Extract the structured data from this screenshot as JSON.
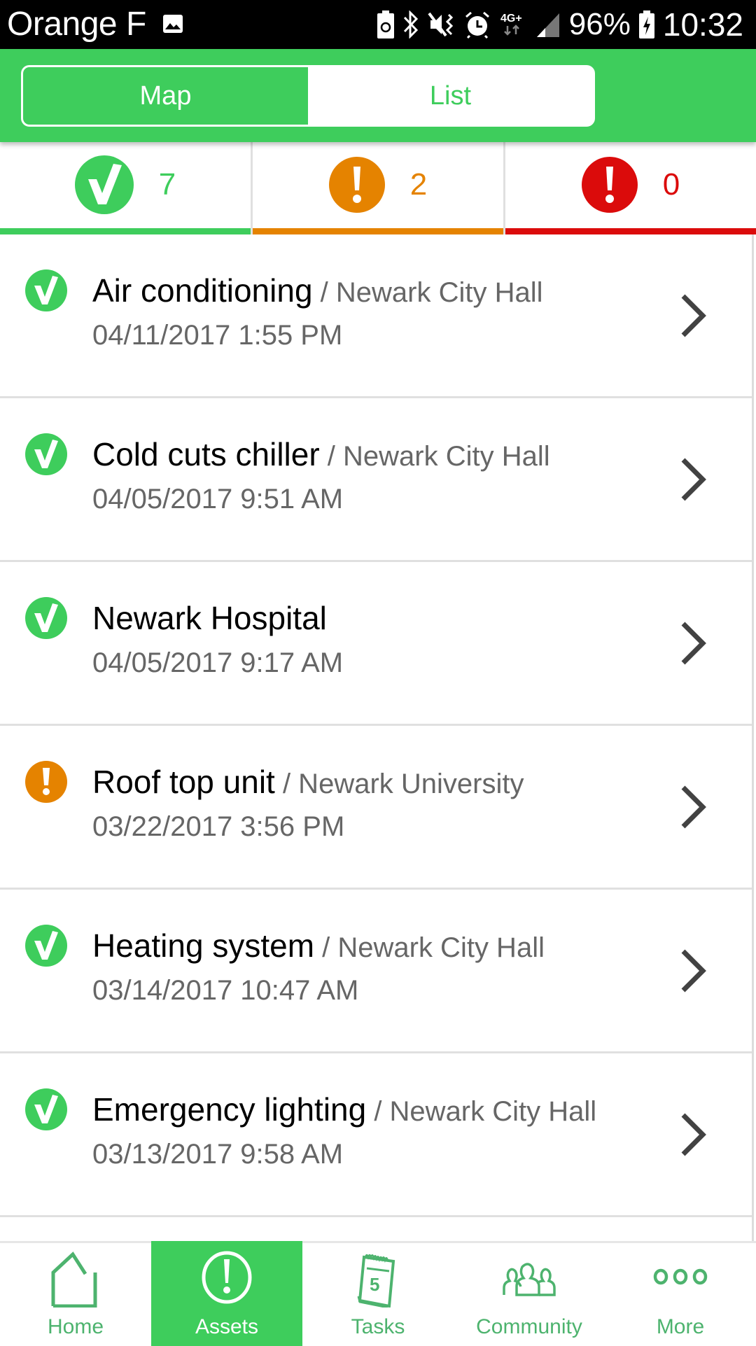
{
  "status_bar": {
    "carrier": "Orange F",
    "icons": [
      "gallery-icon",
      "battery-saver-icon",
      "bluetooth-icon",
      "vibrate-mute-icon",
      "alarm-icon",
      "network-4g-plus-icon",
      "signal-icon",
      "battery-charging-icon"
    ],
    "network": "4G+",
    "battery": "96%",
    "time": "10:32"
  },
  "header": {
    "toggle": [
      {
        "label": "Map",
        "selected": true
      },
      {
        "label": "List",
        "selected": false
      }
    ]
  },
  "summary": [
    {
      "status": "ok",
      "icon": "check-circle-icon",
      "count": "7",
      "color": "#3ecd5c"
    },
    {
      "status": "warning",
      "icon": "exclamation-circle-icon",
      "count": "2",
      "color": "#e58300"
    },
    {
      "status": "alarm",
      "icon": "exclamation-circle-icon",
      "count": "0",
      "color": "#db0b0b"
    }
  ],
  "assets": [
    {
      "status": "ok",
      "name": "Air conditioning",
      "location": " / Newark City Hall",
      "date": "04/11/2017 1:55 PM"
    },
    {
      "status": "ok",
      "name": "Cold cuts chiller",
      "location": " / Newark City Hall",
      "date": "04/05/2017 9:51 AM"
    },
    {
      "status": "ok",
      "name": "Newark Hospital",
      "location": "",
      "date": "04/05/2017 9:17 AM"
    },
    {
      "status": "warning",
      "name": "Roof top unit",
      "location": " / Newark University",
      "date": "03/22/2017 3:56 PM"
    },
    {
      "status": "ok",
      "name": "Heating system",
      "location": " / Newark City Hall",
      "date": "03/14/2017 10:47 AM"
    },
    {
      "status": "ok",
      "name": "Emergency lighting",
      "location": " / Newark City Hall",
      "date": "03/13/2017 9:58 AM"
    }
  ],
  "bottom_nav": [
    {
      "label": "Home",
      "icon": "home-icon",
      "active": false
    },
    {
      "label": "Assets",
      "icon": "exclamation-circle-icon",
      "active": true
    },
    {
      "label": "Tasks",
      "icon": "calendar-icon",
      "badge": "5",
      "active": false
    },
    {
      "label": "Community",
      "icon": "people-icon",
      "active": false
    },
    {
      "label": "More",
      "icon": "more-dots-icon",
      "active": false
    }
  ],
  "colors": {
    "brand_green": "#3ecd5c",
    "nav_green": "#4db36e",
    "warning_orange": "#e58300",
    "alarm_red": "#db0b0b",
    "chevron": "#424242"
  }
}
